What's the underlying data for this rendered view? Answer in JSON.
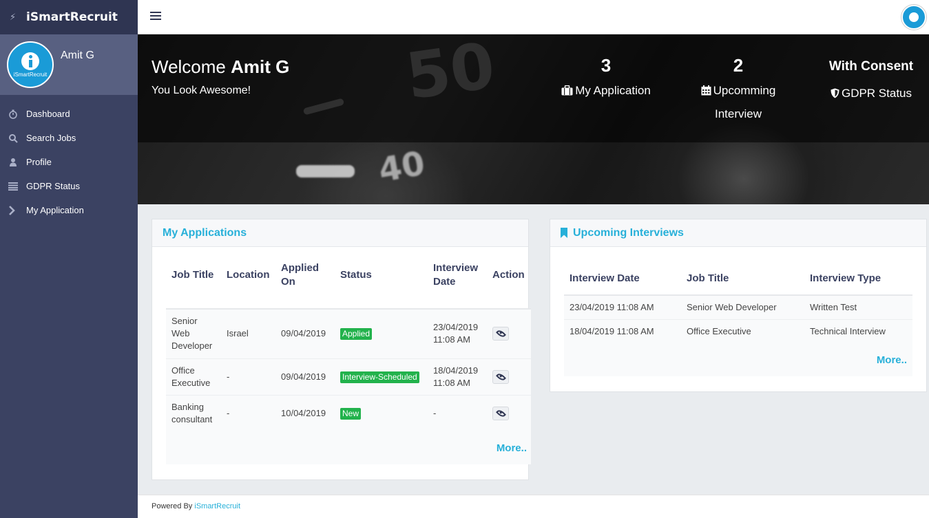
{
  "brand": {
    "name": "iSmartRecruit",
    "icon": "bolt-icon"
  },
  "user": {
    "name": "Amit G",
    "avatar_text": "iSmartRecruit"
  },
  "nav": [
    {
      "label": "Dashboard",
      "icon": "stopwatch-icon"
    },
    {
      "label": "Search Jobs",
      "icon": "search-icon"
    },
    {
      "label": "Profile",
      "icon": "user-icon"
    },
    {
      "label": "GDPR Status",
      "icon": "list-icon"
    },
    {
      "label": "My Application",
      "icon": "chevron-right-icon"
    }
  ],
  "hero": {
    "welcome_prefix": "Welcome",
    "welcome_name": "Amit G",
    "tagline": "You Look Awesome!",
    "stats": {
      "applications": {
        "value": "3",
        "label": "My Application",
        "icon": "briefcase-icon"
      },
      "interviews": {
        "value": "2",
        "label_line1": "Upcomming",
        "label_line2": "Interview",
        "icon": "calendar-icon"
      },
      "gdpr": {
        "value": "With Consent",
        "label": "GDPR Status",
        "icon": "shield-icon"
      }
    }
  },
  "applications": {
    "title": "My Applications",
    "headers": {
      "job_title": "Job Title",
      "location": "Location",
      "applied_on": "Applied On",
      "status": "Status",
      "interview_date": "Interview Date",
      "action": "Action"
    },
    "rows": [
      {
        "job_title": "Senior Web Developer",
        "location": "Israel",
        "applied_on": "09/04/2019",
        "status": "Applied",
        "interview_date": "23/04/2019 11:08 AM"
      },
      {
        "job_title": "Office Executive",
        "location": "-",
        "applied_on": "09/04/2019",
        "status": "Interview-Scheduled",
        "interview_date": "18/04/2019 11:08 AM"
      },
      {
        "job_title": "Banking consultant",
        "location": "-",
        "applied_on": "10/04/2019",
        "status": "New",
        "interview_date": "-"
      }
    ],
    "more": "More.."
  },
  "interviews": {
    "title": "Upcoming Interviews",
    "headers": {
      "date": "Interview Date",
      "job_title": "Job Title",
      "type": "Interview Type"
    },
    "rows": [
      {
        "date": "23/04/2019 11:08 AM",
        "job_title": "Senior Web Developer",
        "type": "Written Test"
      },
      {
        "date": "18/04/2019 11:08 AM",
        "job_title": "Office Executive",
        "type": "Technical Interview"
      }
    ],
    "more": "More.."
  },
  "footer": {
    "prefix": "Powered By",
    "link": "iSmartRecruit"
  },
  "colors": {
    "sidebar": "#3b4262",
    "accent": "#27b0d9",
    "badge": "#22b24c"
  },
  "hero_decor": {
    "big_number": "50",
    "small_number": "40"
  }
}
